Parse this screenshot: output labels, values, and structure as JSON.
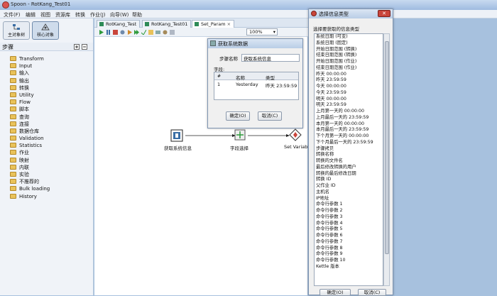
{
  "window": {
    "title": "Spoon - RotKang_Test01"
  },
  "menu": [
    "文件(F)",
    "编辑",
    "视图",
    "资源库",
    "转换",
    "作业(J)",
    "向导(W)",
    "帮助"
  ],
  "perspectives": {
    "main_object": "主对象树",
    "core_object": "核心对象"
  },
  "steps_header": "步骤",
  "tree_items": [
    "Transform",
    "Input",
    "输入",
    "输出",
    "转换",
    "Utility",
    "Flow",
    "脚本",
    "查询",
    "连接",
    "数据仓库",
    "Validation",
    "Statistics",
    "作业",
    "映射",
    "内联",
    "实验",
    "不推荐的",
    "Bulk loading",
    "History"
  ],
  "tabs": [
    "RotKang_Test",
    "RotKang_Test01",
    "Set_Param"
  ],
  "zoom": "100%",
  "canvas_steps": {
    "step1": "获取系统信息",
    "step2": "字段选择",
    "step3": "Set Variables"
  },
  "sysinfo_dialog": {
    "title": "获取系统数据",
    "step_name_label": "步骤名称",
    "step_name_value": "获取系统信息",
    "fields_label": "字段:",
    "col_num": "#",
    "col_name": "名称",
    "col_type": "类型",
    "row_num": "1",
    "row_name": "Yesterday",
    "row_type": "昨天 23:59:59",
    "ok": "确定(O)",
    "cancel": "取消(C)"
  },
  "info_dialog": {
    "title": "选择信息类型",
    "prompt": "选择要获取的信息类型",
    "items": [
      "系统日期 (可变)",
      "系统日期 (固定)",
      "开始日期范围 (转换)",
      "结束日期范围 (转换)",
      "开始日期范围 (作业)",
      "结束日期范围 (作业)",
      "昨天 00:00:00",
      "昨天 23:59:59",
      "今天 00:00:00",
      "今天 23:59:59",
      "明天 00:00:00",
      "明天 23:59:59",
      "上月第一天的 00:00:00",
      "上月最后一天的 23:59:59",
      "本月第一天的 00:00:00",
      "本月最后一天的  23:59:59",
      "下个月第一天的 00:00:00",
      "下个月最后一天的 23:59:59",
      "步骤拷贝",
      "转换名称",
      "转换的文件名",
      "最后修改转换的用户",
      "转换的最后修改日期",
      "转换 ID",
      "父作业 ID",
      "主机名",
      "IP地址",
      "命令行参数 1",
      "命令行参数 2",
      "命令行参数 3",
      "命令行参数 4",
      "命令行参数 5",
      "命令行参数 6",
      "命令行参数 7",
      "命令行参数 8",
      "命令行参数 9",
      "命令行参数 10",
      "Kettle 版本"
    ],
    "ok": "确定(O)",
    "cancel": "取消(C)"
  }
}
